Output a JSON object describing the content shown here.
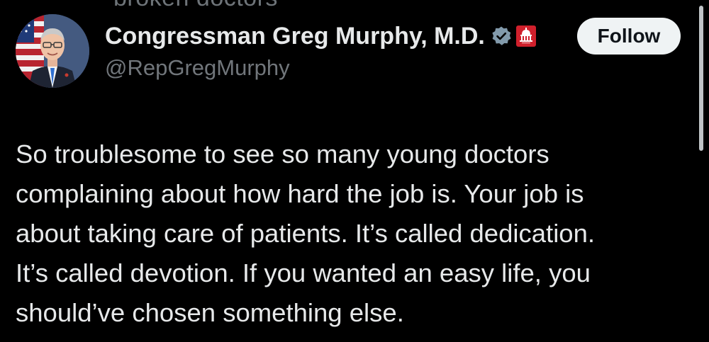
{
  "top_clipped_text": "broken doctors",
  "author": {
    "display_name": "Congressman Greg Murphy, M.D.",
    "handle": "@RepGregMurphy",
    "avatar_icon": "portrait-avatar",
    "verified_icon": "verified-badge-icon",
    "affiliation_icon": "us-capitol-badge-icon",
    "verified_color": "#829aab",
    "affiliation_color": "#d0202c"
  },
  "follow_button": {
    "label": "Follow"
  },
  "tweet": {
    "lines": [
      "So troublesome to see so many young doctors",
      "complaining about how hard the job is. Your job is",
      "about taking care of patients. It’s called dedication.",
      "It’s called devotion. If you wanted an easy life, you",
      "should’ve chosen something else."
    ]
  },
  "colors": {
    "background": "#000000",
    "text_primary": "#e7e9ea",
    "text_secondary": "#71767b",
    "button_bg": "#eff3f4",
    "button_text": "#0f1419"
  }
}
